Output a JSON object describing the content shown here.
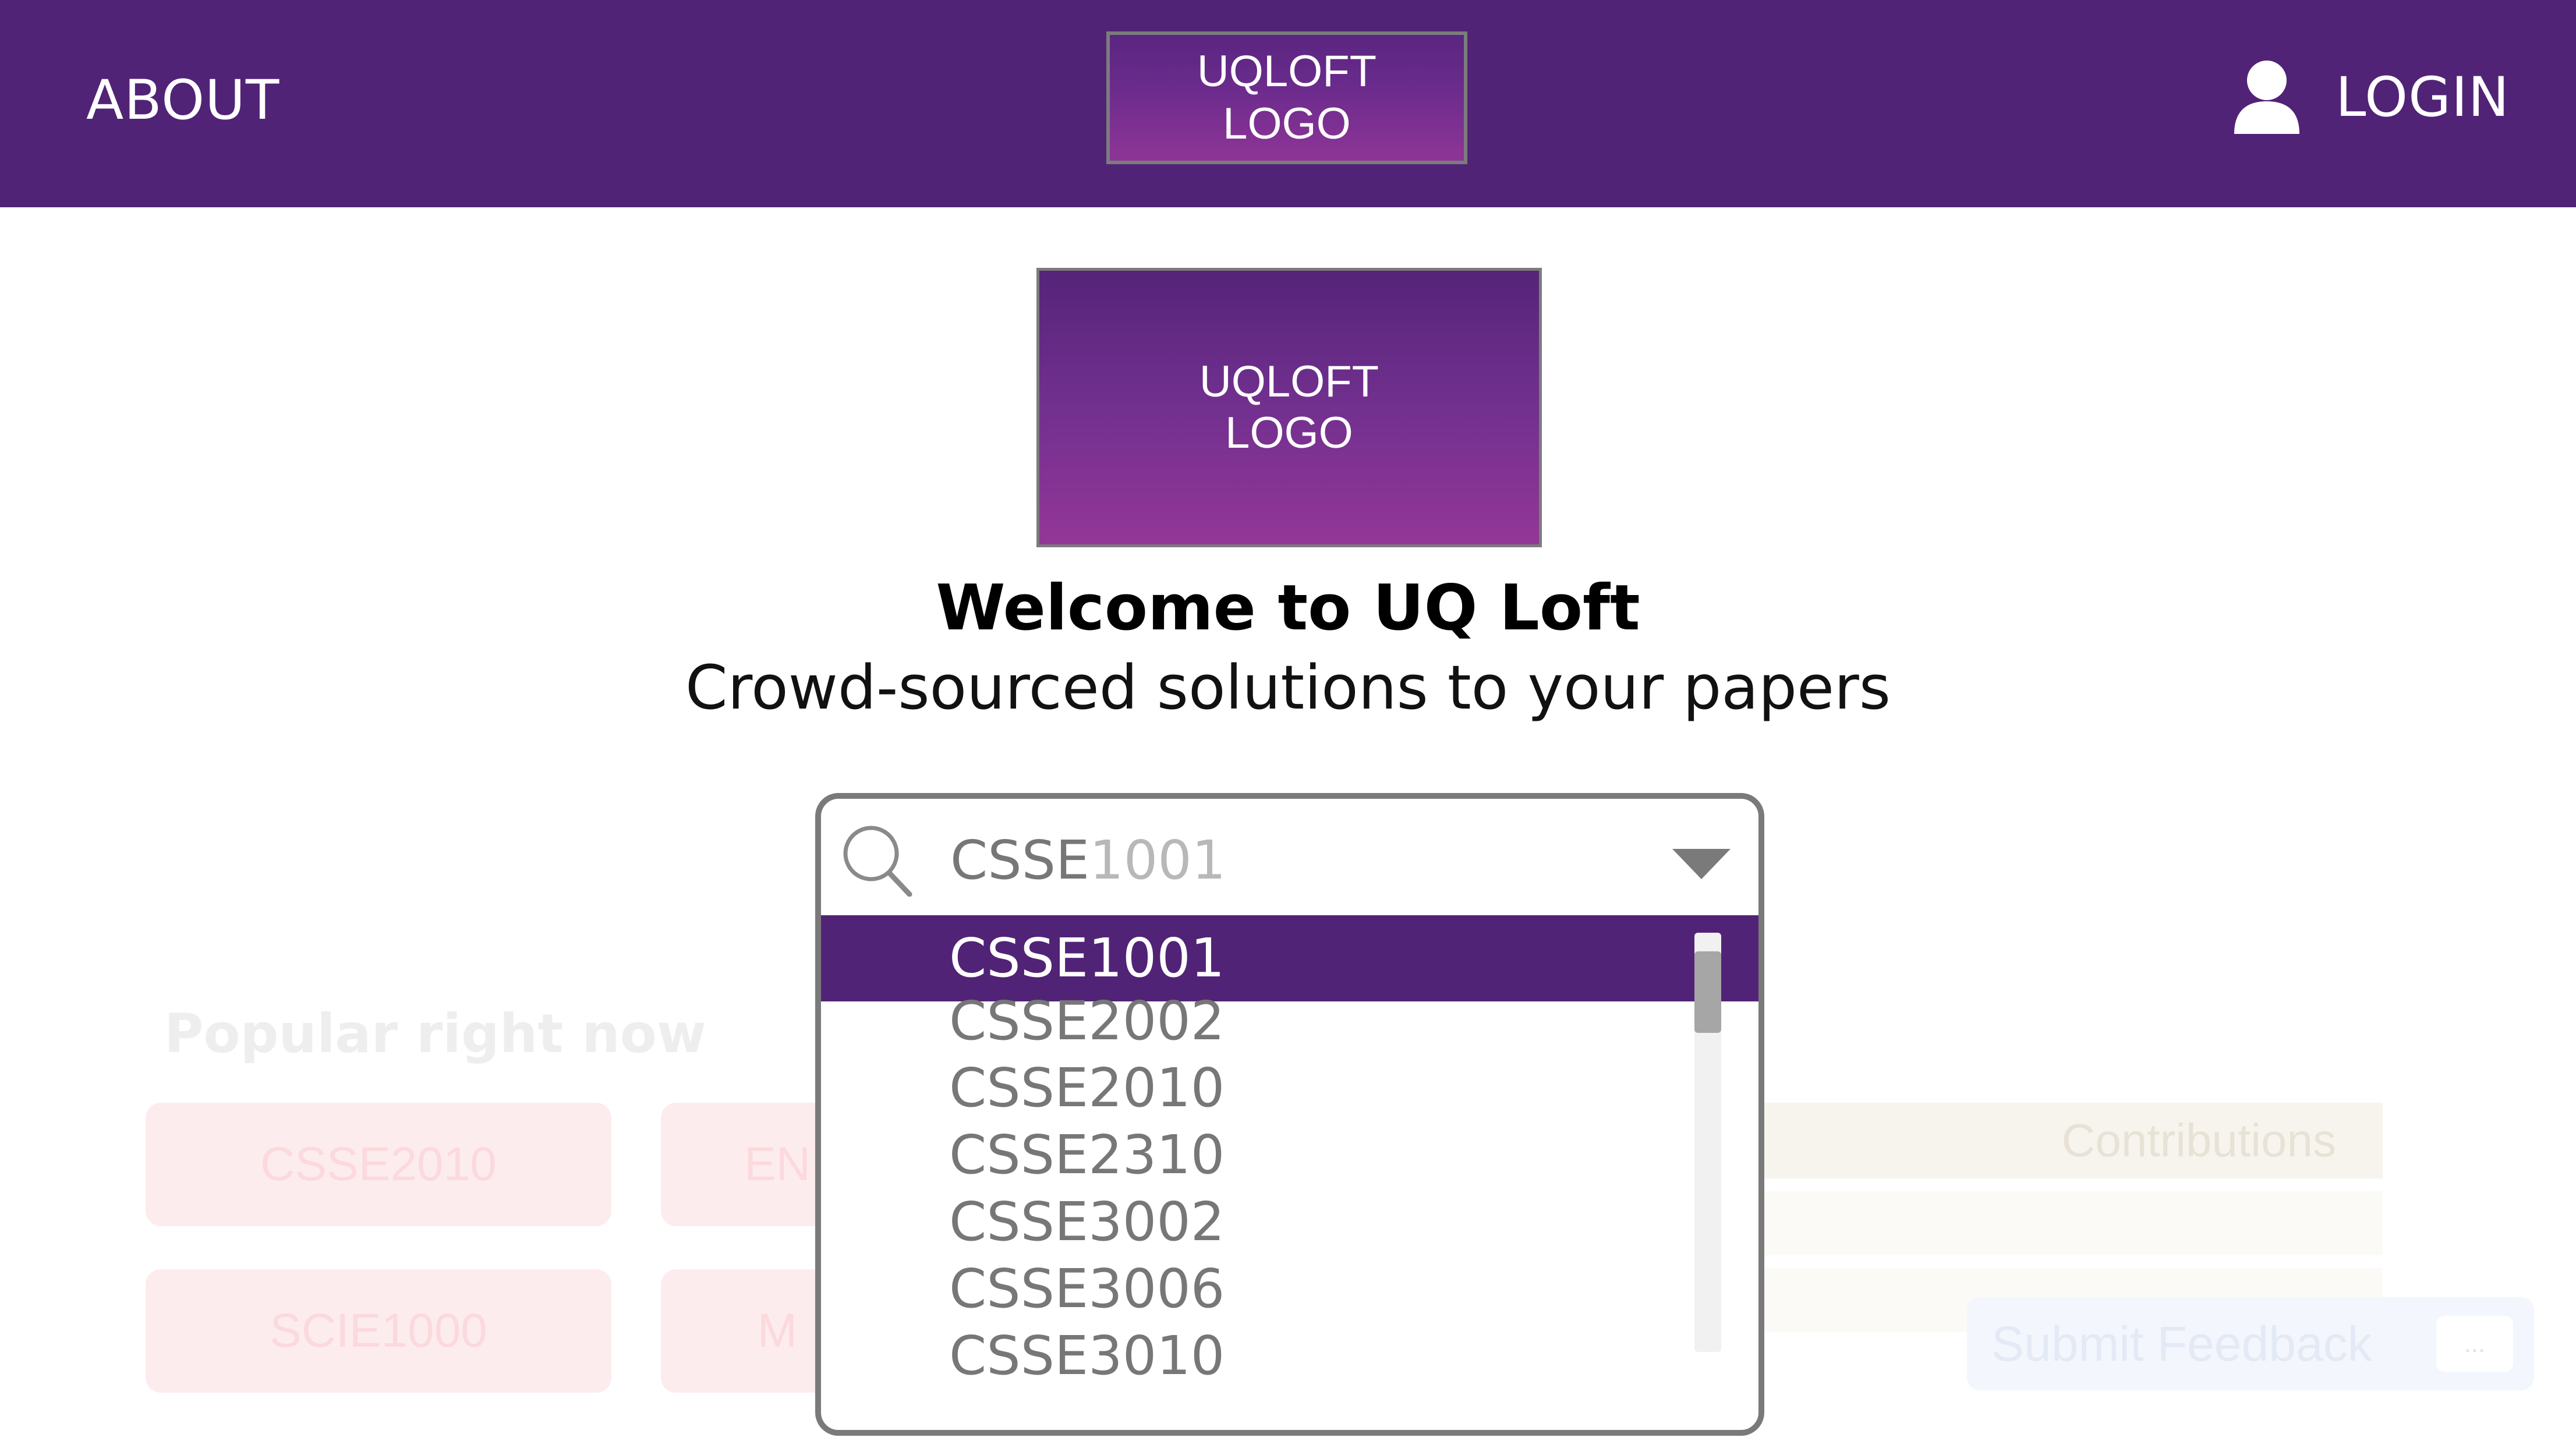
{
  "header": {
    "about_label": "ABOUT",
    "logo_text": "UQLOFT LOGO",
    "logo_line1": "UQLOFT",
    "logo_line2": "LOGO",
    "login_label": "LOGIN",
    "login_icon": "user-icon",
    "background_color": "#512376"
  },
  "hero": {
    "logo_line1": "UQLOFT",
    "logo_line2": "LOGO",
    "welcome": "Welcome to UQ Loft",
    "tagline": "Crowd-sourced solutions to your papers"
  },
  "search": {
    "typed": "CSSE",
    "suggestion": "1001",
    "icon": "search-icon",
    "toggle_icon": "caret-down-icon",
    "options": [
      "CSSE1001",
      "CSSE2002",
      "CSSE2010",
      "CSSE2310",
      "CSSE3002",
      "CSSE3006",
      "CSSE3010"
    ],
    "selected_index": 0,
    "accent_color": "#512376"
  },
  "background": {
    "popular_title": "Popular right now",
    "cards": [
      "CSSE2010",
      "EN",
      "SCIE1000",
      "M"
    ],
    "contributions_header": "Contributions",
    "feedback_label": "Submit Feedback",
    "feedback_icon": "chat-bubble-icon",
    "feedback_bubble_text": "..."
  }
}
